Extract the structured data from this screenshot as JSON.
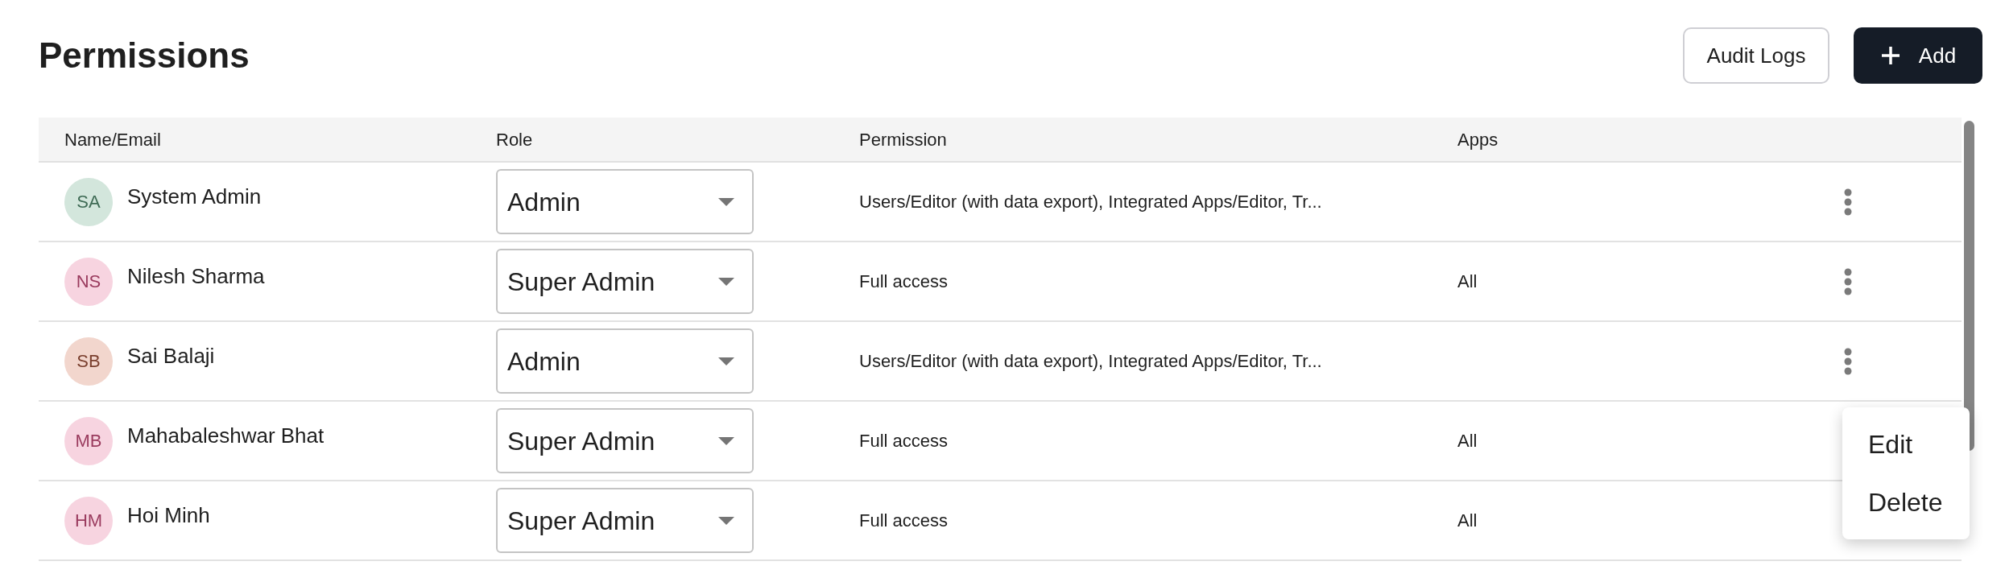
{
  "title": "Permissions",
  "actions": {
    "audit_logs": "Audit Logs",
    "add": "Add"
  },
  "table": {
    "columns": [
      "Name/Email",
      "Role",
      "Permission",
      "Apps"
    ],
    "rows": [
      {
        "initials": "SA",
        "name": "System Admin",
        "color": "#d3e6dc",
        "role": "Admin",
        "permission": "Users/Editor (with data export), Integrated Apps/Editor, Tr...",
        "apps": ""
      },
      {
        "initials": "NS",
        "name": "Nilesh Sharma",
        "color": "#f7d4e0",
        "role": "Super Admin",
        "permission": "Full access",
        "apps": "All"
      },
      {
        "initials": "SB",
        "name": "Sai Balaji",
        "color": "#f2d6cd",
        "role": "Admin",
        "permission": "Users/Editor (with data export), Integrated Apps/Editor, Tr...",
        "apps": "",
        "menu": [
          "Edit",
          "Delete"
        ]
      },
      {
        "initials": "MB",
        "name": "Mahabaleshwar Bhat",
        "color": "#f7d4e0",
        "role": "Super Admin",
        "permission": "Full access",
        "apps": "All"
      },
      {
        "initials": "HM",
        "name": "Hoi Minh",
        "color": "#f7d4e0",
        "role": "Super Admin",
        "permission": "Full access",
        "apps": "All"
      }
    ]
  }
}
